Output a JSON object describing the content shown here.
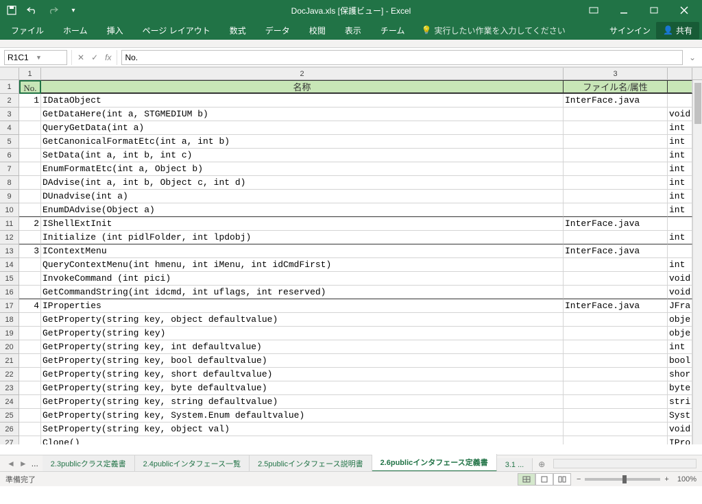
{
  "title": "DocJava.xls  [保護ビュー] - Excel",
  "qat": {
    "save": "save-icon",
    "undo": "undo-icon",
    "redo": "redo-icon"
  },
  "ribbon": {
    "tabs": [
      "ファイル",
      "ホーム",
      "挿入",
      "ページ レイアウト",
      "数式",
      "データ",
      "校閲",
      "表示",
      "チーム"
    ],
    "tell_me": "実行したい作業を入力してください",
    "signin": "サインイン",
    "share": "共有"
  },
  "namebox": "R1C1",
  "formula": "No.",
  "colnums": [
    "1",
    "2",
    "3",
    ""
  ],
  "headers": {
    "c1": "No.",
    "c2": "名称",
    "c3": "ファイル名/属性",
    "c4": ""
  },
  "rows": [
    {
      "r": "2",
      "n": "1",
      "name": "IDataObject",
      "file": "InterFace.java",
      "t": ""
    },
    {
      "r": "3",
      "n": "",
      "name": "GetDataHere(int a, STGMEDIUM b)",
      "file": "",
      "t": "void"
    },
    {
      "r": "4",
      "n": "",
      "name": "QueryGetData(int a)",
      "file": "",
      "t": "int"
    },
    {
      "r": "5",
      "n": "",
      "name": "GetCanonicalFormatEtc(int a, int b)",
      "file": "",
      "t": "int"
    },
    {
      "r": "6",
      "n": "",
      "name": "SetData(int a, int b, int c)",
      "file": "",
      "t": "int"
    },
    {
      "r": "7",
      "n": "",
      "name": "EnumFormatEtc(int a, Object b)",
      "file": "",
      "t": "int"
    },
    {
      "r": "8",
      "n": "",
      "name": "DAdvise(int a, int b, Object c, int d)",
      "file": "",
      "t": "int"
    },
    {
      "r": "9",
      "n": "",
      "name": "DUnadvise(int a)",
      "file": "",
      "t": "int"
    },
    {
      "r": "10",
      "n": "",
      "name": "EnumDAdvise(Object a)",
      "file": "",
      "t": "int",
      "bb": true
    },
    {
      "r": "11",
      "n": "2",
      "name": "IShellExtInit",
      "file": "InterFace.java",
      "t": ""
    },
    {
      "r": "12",
      "n": "",
      "name": "Initialize (int pidlFolder, int lpdobj)",
      "file": "",
      "t": "int",
      "bb": true
    },
    {
      "r": "13",
      "n": "3",
      "name": "IContextMenu",
      "file": "InterFace.java",
      "t": ""
    },
    {
      "r": "14",
      "n": "",
      "name": "QueryContextMenu(int hmenu, int iMenu, int idCmdFirst)",
      "file": "",
      "t": "int"
    },
    {
      "r": "15",
      "n": "",
      "name": "InvokeCommand (int pici)",
      "file": "",
      "t": "void"
    },
    {
      "r": "16",
      "n": "",
      "name": "GetCommandString(int idcmd, int uflags, int reserved)",
      "file": "",
      "t": "void",
      "bb": true
    },
    {
      "r": "17",
      "n": "4",
      "name": "IProperties",
      "file": "InterFace.java",
      "t": "JFra"
    },
    {
      "r": "18",
      "n": "",
      "name": "GetProperty(string key, object defaultvalue)",
      "file": "",
      "t": "obje"
    },
    {
      "r": "19",
      "n": "",
      "name": "GetProperty(string key)",
      "file": "",
      "t": "obje"
    },
    {
      "r": "20",
      "n": "",
      "name": "GetProperty(string key, int defaultvalue)",
      "file": "",
      "t": "int"
    },
    {
      "r": "21",
      "n": "",
      "name": "GetProperty(string key, bool defaultvalue)",
      "file": "",
      "t": "bool"
    },
    {
      "r": "22",
      "n": "",
      "name": "GetProperty(string key, short defaultvalue)",
      "file": "",
      "t": "shor"
    },
    {
      "r": "23",
      "n": "",
      "name": "GetProperty(string key, byte defaultvalue)",
      "file": "",
      "t": "byte"
    },
    {
      "r": "24",
      "n": "",
      "name": "GetProperty(string key, string defaultvalue)",
      "file": "",
      "t": "stri"
    },
    {
      "r": "25",
      "n": "",
      "name": "GetProperty(string key, System.Enum defaultvalue)",
      "file": "",
      "t": "Syst"
    },
    {
      "r": "26",
      "n": "",
      "name": "SetProperty(string key, object val)",
      "file": "",
      "t": "void"
    },
    {
      "r": "27",
      "n": "",
      "name": "Clone()",
      "file": "",
      "t": "IPro"
    }
  ],
  "sheets": {
    "dots": "...",
    "tabs": [
      {
        "label": "2.3publicクラス定義書",
        "active": false
      },
      {
        "label": "2.4publicインタフェース一覧",
        "active": false
      },
      {
        "label": "2.5publicインタフェース説明書",
        "active": false
      },
      {
        "label": "2.6publicインタフェース定義書",
        "active": true
      },
      {
        "label": "3.1 ...",
        "active": false
      }
    ],
    "add": "+"
  },
  "status": {
    "ready": "準備完了",
    "zoom": "100%"
  }
}
